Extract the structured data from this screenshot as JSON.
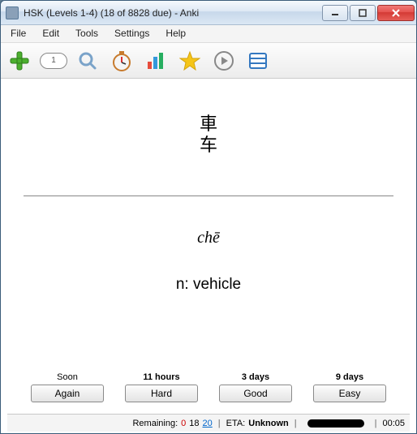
{
  "window": {
    "title": "HSK (Levels 1-4) (18 of 8828 due) - Anki"
  },
  "menu": {
    "file": "File",
    "edit": "Edit",
    "tools": "Tools",
    "settings": "Settings",
    "help": "Help"
  },
  "toolbar": {
    "counter": "1"
  },
  "card": {
    "hanzi_trad": "車",
    "hanzi_simp": "车",
    "pinyin": "chē",
    "meaning": "n: vehicle"
  },
  "answers": {
    "again": {
      "interval": "Soon",
      "label": "Again"
    },
    "hard": {
      "interval": "11 hours",
      "label": "Hard"
    },
    "good": {
      "interval": "3 days",
      "label": "Good"
    },
    "easy": {
      "interval": "9 days",
      "label": "Easy"
    }
  },
  "status": {
    "remaining_label": "Remaining:",
    "remaining_new": "0",
    "remaining_learn": "18",
    "remaining_due": "20",
    "eta_label": "ETA:",
    "eta_value": "Unknown",
    "timer": "00:05"
  }
}
